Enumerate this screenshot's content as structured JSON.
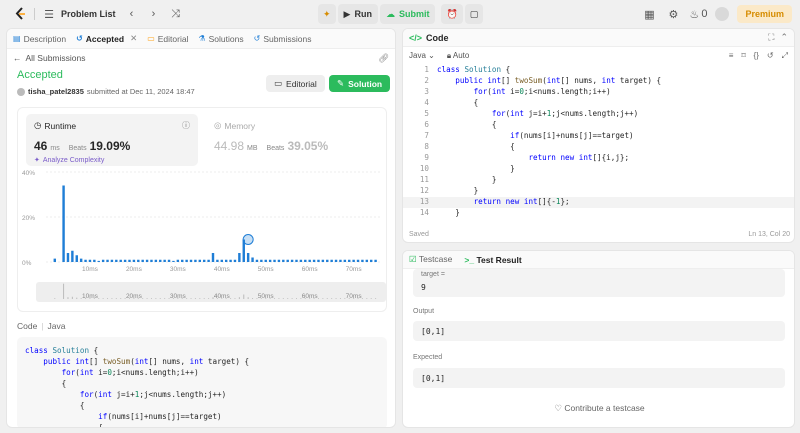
{
  "topbar": {
    "title": "Problem List",
    "run_label": "Run",
    "submit_label": "Submit",
    "streak": "0",
    "premium_label": "Premium"
  },
  "left_tabs": [
    {
      "label": "Description",
      "active": false
    },
    {
      "label": "Accepted",
      "active": true
    },
    {
      "label": "Editorial",
      "active": false
    },
    {
      "label": "Solutions",
      "active": false
    },
    {
      "label": "Submissions",
      "active": false
    }
  ],
  "submission": {
    "back_label": "All Submissions",
    "status": "Accepted",
    "user": "tisha_patel2835",
    "submitted_text": "submitted at Dec 11, 2024 18:47",
    "editorial_label": "Editorial",
    "solution_label": "Solution"
  },
  "runtime": {
    "title": "Runtime",
    "value": "46",
    "unit": "ms",
    "beats_label": "Beats",
    "beats": "19.09%",
    "analyze_label": "Analyze Complexity"
  },
  "memory": {
    "title": "Memory",
    "value": "44.98",
    "unit": "MB",
    "beats_label": "Beats",
    "beats": "39.05%"
  },
  "chart_data": {
    "type": "bar",
    "y_ticks": [
      "40%",
      "20%",
      "0%"
    ],
    "ylim": [
      0,
      40
    ],
    "x_ticks": [
      "10ms",
      "20ms",
      "30ms",
      "40ms",
      "50ms",
      "60ms",
      "70ms"
    ],
    "x_tick_values": [
      10,
      20,
      30,
      40,
      50,
      60,
      70
    ],
    "xlim": [
      0,
      76
    ],
    "x": [
      2,
      4,
      5,
      6,
      7,
      8,
      9,
      10,
      11,
      12,
      13,
      14,
      15,
      16,
      17,
      18,
      19,
      20,
      21,
      22,
      23,
      24,
      25,
      26,
      27,
      28,
      29,
      30,
      31,
      32,
      33,
      34,
      35,
      36,
      37,
      38,
      39,
      40,
      41,
      42,
      43,
      44,
      45,
      46,
      47,
      48,
      49,
      50,
      51,
      52,
      53,
      54,
      55,
      56,
      57,
      58,
      59,
      60,
      61,
      62,
      63,
      64,
      65,
      66,
      67,
      68,
      69,
      70,
      71,
      72,
      73,
      74,
      75
    ],
    "values": [
      1.5,
      34,
      4,
      5,
      3,
      1.5,
      1,
      1,
      1,
      0.5,
      1,
      1,
      1,
      1,
      1,
      1,
      1,
      1,
      1,
      1,
      1,
      1,
      1,
      1,
      1,
      1,
      0.5,
      1,
      1,
      1,
      1,
      1,
      1,
      1,
      1,
      4,
      1,
      1,
      1,
      1,
      1,
      4,
      10,
      4,
      2,
      1,
      1,
      1,
      1,
      1,
      1,
      1,
      1,
      1,
      1,
      1,
      1,
      1,
      1,
      1,
      1,
      1,
      1,
      1,
      1,
      1,
      1,
      1,
      1,
      1,
      1,
      1,
      1
    ],
    "highlight_x": 46,
    "highlight_value": 10
  },
  "left_code": {
    "header": "Code",
    "lang": "Java",
    "lines": [
      "class Solution {",
      "    public int[] twoSum(int[] nums, int target) {",
      "        for(int i=0;i<nums.length;i++)",
      "        {",
      "            for(int j=i+1;j<nums.length;j++)",
      "            {",
      "                if(nums[i]+nums[j]==target)",
      "                {"
    ]
  },
  "editor": {
    "title": "Code",
    "lang": "Java",
    "mode": "Auto",
    "saved": "Saved",
    "cursor": "Ln 13, Col 20",
    "lines": [
      "class Solution {",
      "    public int[] twoSum(int[] nums, int target) {",
      "        for(int i=0;i<nums.length;i++)",
      "        {",
      "            for(int j=i+1;j<nums.length;j++)",
      "            {",
      "                if(nums[i]+nums[j]==target)",
      "                {",
      "                    return new int[]{i,j};",
      "                }",
      "            }",
      "        }",
      "        return new int[]{-1};",
      "    }"
    ],
    "active_line": 13
  },
  "testpanel": {
    "tab1": "Testcase",
    "tab2": "Test Result",
    "target_label": "target =",
    "target_value": "9",
    "output_label": "Output",
    "output_value": "[0,1]",
    "expected_label": "Expected",
    "expected_value": "[0,1]",
    "contribute_label": "Contribute a testcase"
  },
  "colors": {
    "accent_green": "#2cbb5d",
    "bar_blue": "#1f7ed6",
    "premium_text": "#d68c00"
  }
}
